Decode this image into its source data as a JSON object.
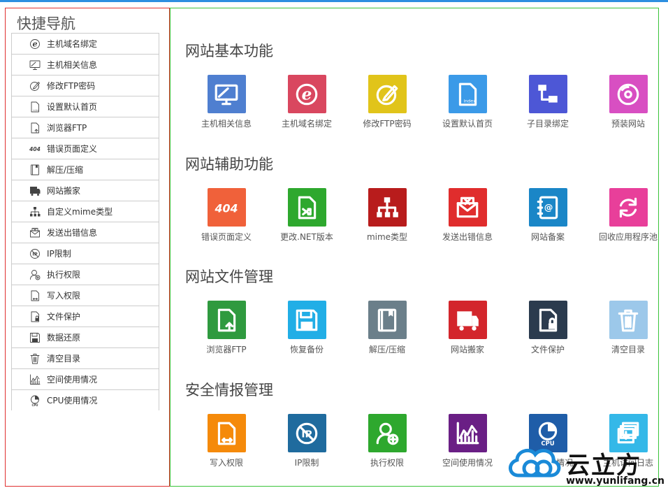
{
  "sidebar": {
    "title": "快捷导航",
    "items": [
      {
        "label": "主机域名绑定",
        "icon": "domain-bind-icon"
      },
      {
        "label": "主机相关信息",
        "icon": "monitor-icon"
      },
      {
        "label": "修改FTP密码",
        "icon": "edit-icon"
      },
      {
        "label": "设置默认首页",
        "icon": "index-page-icon"
      },
      {
        "label": "浏览器FTP",
        "icon": "file-upload-icon"
      },
      {
        "label": "错误页面定义",
        "icon": "error-404-icon"
      },
      {
        "label": "解压/压缩",
        "icon": "archive-icon"
      },
      {
        "label": "网站搬家",
        "icon": "truck-icon"
      },
      {
        "label": "自定义mime类型",
        "icon": "sitemap-icon"
      },
      {
        "label": "发送出错信息",
        "icon": "mail-error-icon"
      },
      {
        "label": "IP限制",
        "icon": "ip-block-icon"
      },
      {
        "label": "执行权限",
        "icon": "user-permission-icon"
      },
      {
        "label": "写入权限",
        "icon": "write-file-icon"
      },
      {
        "label": "文件保护",
        "icon": "file-lock-icon"
      },
      {
        "label": "数据还原",
        "icon": "floppy-icon"
      },
      {
        "label": "清空目录",
        "icon": "trash-icon"
      },
      {
        "label": "空间使用情况",
        "icon": "chart-icon"
      },
      {
        "label": "CPU使用情况",
        "icon": "cpu-pie-icon"
      }
    ]
  },
  "sections": [
    {
      "title": "网站基本功能",
      "tiles": [
        {
          "label": "主机相关信息",
          "icon": "monitor-icon",
          "color": "#4f7fd0"
        },
        {
          "label": "主机域名绑定",
          "icon": "domain-bind-icon",
          "color": "#d9475f"
        },
        {
          "label": "修改FTP密码",
          "icon": "edit-icon",
          "color": "#e1c41a"
        },
        {
          "label": "设置默认首页",
          "icon": "index-page-icon",
          "color": "#3b9ae8"
        },
        {
          "label": "子目录绑定",
          "icon": "folder-tree-icon",
          "color": "#4d57d6"
        },
        {
          "label": "预装网站",
          "icon": "disc-icon",
          "color": "#d84fc2"
        }
      ]
    },
    {
      "title": "网站辅助功能",
      "tiles": [
        {
          "label": "错误页面定义",
          "icon": "error-404-icon",
          "color": "#f0613a"
        },
        {
          "label": "更改.NET版本",
          "icon": "file-shuffle-icon",
          "color": "#2ea82e"
        },
        {
          "label": "mime类型",
          "icon": "sitemap-icon",
          "color": "#b81c1c"
        },
        {
          "label": "发送出错信息",
          "icon": "mail-error-icon",
          "color": "#e02d2d"
        },
        {
          "label": "网站备案",
          "icon": "contact-book-icon",
          "color": "#1a86c7"
        },
        {
          "label": "回收应用程序池",
          "icon": "recycle-icon",
          "color": "#e83f9a"
        }
      ]
    },
    {
      "title": "网站文件管理",
      "tiles": [
        {
          "label": "浏览器FTP",
          "icon": "file-upload-icon",
          "color": "#2f9a3f"
        },
        {
          "label": "恢复备份",
          "icon": "floppy-icon",
          "color": "#21aee6"
        },
        {
          "label": "解压/压缩",
          "icon": "archive-icon",
          "color": "#6b7f8a"
        },
        {
          "label": "网站搬家",
          "icon": "truck-icon",
          "color": "#d3262c"
        },
        {
          "label": "文件保护",
          "icon": "file-lock-icon",
          "color": "#2b3b4e"
        },
        {
          "label": "清空目录",
          "icon": "trash-icon",
          "color": "#9cc8ea"
        }
      ]
    },
    {
      "title": "安全情报管理",
      "tiles": [
        {
          "label": "写入权限",
          "icon": "write-file-icon",
          "color": "#f58a0a"
        },
        {
          "label": "IP限制",
          "icon": "ip-block-icon",
          "color": "#1f6b9e"
        },
        {
          "label": "执行权限",
          "icon": "user-permission-icon",
          "color": "#2ea82e"
        },
        {
          "label": "空间使用情况",
          "icon": "chart-icon",
          "color": "#6a1f85"
        },
        {
          "label": "CPU使用情况",
          "icon": "cpu-pie-icon",
          "color": "#1f5da8"
        },
        {
          "label": "主机访问日志",
          "icon": "layers-download-icon",
          "color": "#34b8e8"
        }
      ]
    }
  ],
  "watermark": {
    "brand": "云立方",
    "url": "www.yunlifang.cn"
  }
}
